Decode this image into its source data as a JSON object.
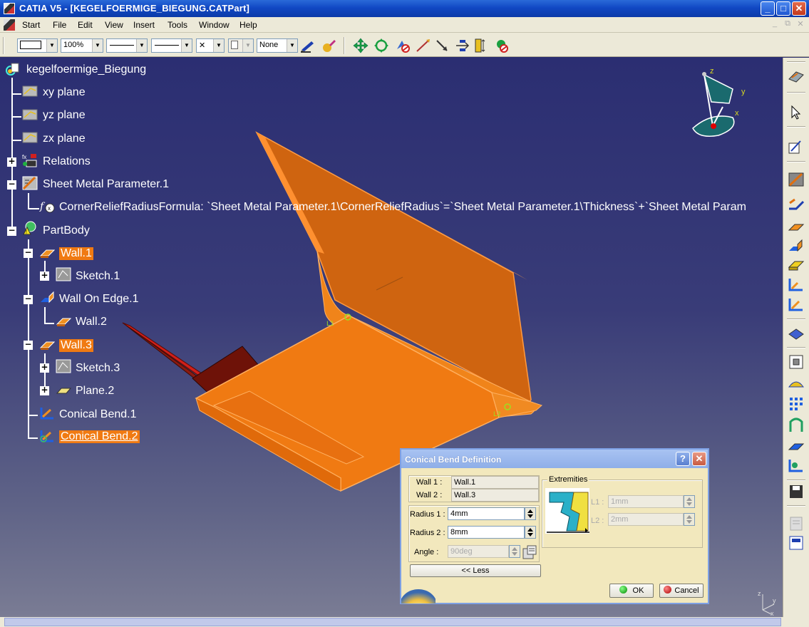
{
  "window": {
    "title": "CATIA V5 - [KEGELFOERMIGE_BIEGUNG.CATPart]",
    "min_label": "_",
    "max_label": "□",
    "close_label": "✕"
  },
  "menu": {
    "items": [
      "Start",
      "File",
      "Edit",
      "View",
      "Insert",
      "Tools",
      "Window",
      "Help"
    ],
    "mdi": [
      "_",
      "⧉",
      "✕"
    ]
  },
  "toolbar": {
    "zoom": "100%",
    "layer": "None",
    "cross": "✕"
  },
  "tree": {
    "root": "kegelfoermige_Biegung",
    "xy": "xy plane",
    "yz": "yz plane",
    "zx": "zx plane",
    "relations": "Relations",
    "smp": "Sheet Metal Parameter.1",
    "formula": "CornerReliefRadiusFormula: `Sheet Metal Parameter.1\\CornerReliefRadius`=`Sheet Metal Parameter.1\\Thickness`+`Sheet Metal Param",
    "partbody": "PartBody",
    "wall1": "Wall.1",
    "sketch1": "Sketch.1",
    "woe": "Wall On Edge.1",
    "wall2": "Wall.2",
    "wall3": "Wall.3",
    "sketch3": "Sketch.3",
    "plane2": "Plane.2",
    "cb1": "Conical Bend.1",
    "cb2": "Conical Bend.2",
    "expand_plus": "+",
    "expand_minus": "−"
  },
  "compass": {
    "z": "z",
    "y": "y",
    "x": "x"
  },
  "axes_small": {
    "z": "z",
    "y": "y",
    "x": "x"
  },
  "dialog": {
    "title": "Conical Bend Definition",
    "help": "?",
    "close": "✕",
    "wall1_label": "Wall 1 :",
    "wall1_value": "Wall.1",
    "wall2_label": "Wall 2 :",
    "wall2_value": "Wall.3",
    "radius1_label": "Radius 1 :",
    "radius1_value": "4mm",
    "radius2_label": "Radius 2 :",
    "radius2_value": "8mm",
    "angle_label": "Angle :",
    "angle_value": "90deg",
    "less_button": "<< Less",
    "extremities_title": "Extremities",
    "l1_label": "L1 :",
    "l1_value": "1mm",
    "l2_label": "L2 :",
    "l2_value": "2mm",
    "ok": "OK",
    "cancel": "Cancel"
  },
  "colors": {
    "part_orange": "#f07a12",
    "wall_dark_red": "#8a1a10",
    "highlight": "#f07a12",
    "viewport_top": "#2b2e72",
    "viewport_bottom": "#7a7c94"
  }
}
